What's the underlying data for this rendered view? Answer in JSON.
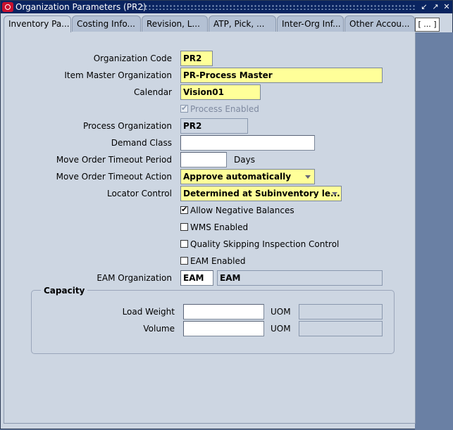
{
  "window": {
    "title": "Organization Parameters (PR2)",
    "buttons": {
      "minimize": "↙",
      "maximize": "↗",
      "close": "✕"
    }
  },
  "tabs": [
    {
      "label": "Inventory Pa...",
      "active": true
    },
    {
      "label": "Costing Info..."
    },
    {
      "label": "Revision, L..."
    },
    {
      "label": "ATP, Pick, ..."
    },
    {
      "label": "Inter-Org Inf..."
    },
    {
      "label": "Other Accou..."
    }
  ],
  "tab_more": "[ ... ]",
  "form": {
    "org_code": {
      "label": "Organization Code",
      "value": "PR2"
    },
    "item_master": {
      "label": "Item Master Organization",
      "value": "PR-Process Master"
    },
    "calendar": {
      "label": "Calendar",
      "value": "Vision01"
    },
    "process_enabled": {
      "label": "Process Enabled",
      "checked": true
    },
    "process_org": {
      "label": "Process Organization",
      "value": "PR2"
    },
    "demand_class": {
      "label": "Demand Class",
      "value": ""
    },
    "move_timeout_period": {
      "label": "Move Order Timeout Period",
      "value": "",
      "unit": "Days"
    },
    "move_timeout_action": {
      "label": "Move Order Timeout Action",
      "value": "Approve automatically"
    },
    "locator_control": {
      "label": "Locator Control",
      "value": "Determined at Subinventory le..."
    },
    "allow_negative": {
      "label": "Allow Negative Balances",
      "checked": true
    },
    "wms_enabled": {
      "label": "WMS Enabled",
      "checked": false
    },
    "quality_skipping": {
      "label": "Quality Skipping Inspection Control",
      "checked": false
    },
    "eam_enabled": {
      "label": "EAM Enabled",
      "checked": false
    },
    "eam_org": {
      "label": "EAM Organization",
      "value": "EAM",
      "desc": "EAM"
    }
  },
  "capacity": {
    "title": "Capacity",
    "load_weight": {
      "label": "Load Weight",
      "value": "",
      "uom_label": "UOM",
      "uom_value": ""
    },
    "volume": {
      "label": "Volume",
      "value": "",
      "uom_label": "UOM",
      "uom_value": ""
    }
  }
}
